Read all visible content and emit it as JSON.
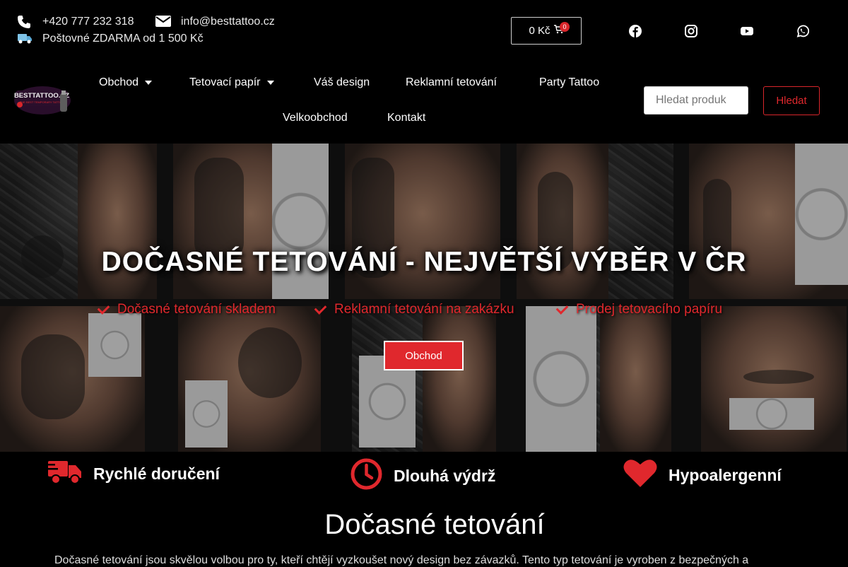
{
  "contact": {
    "phone": "+420 777 232 318",
    "email": "info@besttattoo.cz",
    "shipping": "Poštovné ZDARMA od 1 500 Kč"
  },
  "cart": {
    "total": "0 Kč",
    "count": "0"
  },
  "social": [
    "facebook-icon",
    "instagram-icon",
    "youtube-icon",
    "whatsapp-icon"
  ],
  "logo": {
    "text": "BESTTATTOO.CZ",
    "tagline": "THE BEST TEMPORARY TATTOO"
  },
  "nav": {
    "items": [
      {
        "label": "Obchod",
        "dropdown": true
      },
      {
        "label": "Tetovací papír",
        "dropdown": true
      },
      {
        "label": "Váš design",
        "dropdown": false
      },
      {
        "label": "Reklamní tetování",
        "dropdown": false
      },
      {
        "label": "Party Tattoo",
        "dropdown": false
      },
      {
        "label": "Velkoobchod",
        "dropdown": false
      },
      {
        "label": "Kontakt",
        "dropdown": false
      }
    ]
  },
  "search": {
    "placeholder": "Hledat produk",
    "button": "Hledat"
  },
  "hero": {
    "title": "DOČASNÉ TETOVÁNÍ - NEJVĚTŠÍ VÝBĚR V ČR",
    "features": [
      "Dočasné tetování skladem",
      "Reklamní tetování na zakázku",
      "Prodej tetovacího papíru"
    ],
    "cta": "Obchod"
  },
  "benefits": [
    {
      "icon": "truck-icon",
      "label": "Rychlé doručení"
    },
    {
      "icon": "clock-icon",
      "label": "Dlouhá výdrž"
    },
    {
      "icon": "heart-icon",
      "label": "Hypoalergenní"
    }
  ],
  "section": {
    "title": "Dočasné tetování",
    "intro": "Dočasné tetování jsou skvělou volbou pro ty, kteří chtějí vyzkoušet nový design bez závazků. Tento typ tetování je vyroben z bezpečných a"
  },
  "colors": {
    "accent": "#e0282d",
    "background": "#000000"
  }
}
